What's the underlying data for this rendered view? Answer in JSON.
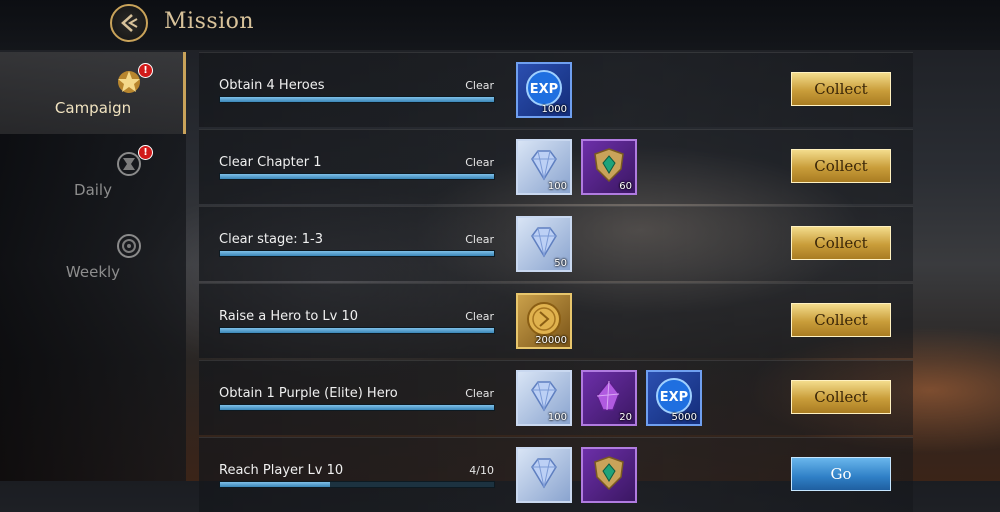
{
  "header": {
    "title": "Mission"
  },
  "sidebar": {
    "tabs": [
      {
        "label": "Campaign",
        "active": true,
        "badge": "!"
      },
      {
        "label": "Daily",
        "active": false,
        "badge": "!"
      },
      {
        "label": "Weekly",
        "active": false,
        "badge": ""
      }
    ]
  },
  "missions": [
    {
      "title": "Obtain 4 Heroes",
      "status": "Clear",
      "progress": 1.0,
      "rewards": [
        {
          "icon": "exp-icon",
          "count": "1000"
        }
      ],
      "button": "Collect"
    },
    {
      "title": "Clear Chapter 1",
      "status": "Clear",
      "progress": 1.0,
      "rewards": [
        {
          "icon": "diamond-icon",
          "count": "100"
        },
        {
          "icon": "shield-emblem-icon",
          "count": "60"
        }
      ],
      "button": "Collect"
    },
    {
      "title": "Clear stage: 1-3",
      "status": "Clear",
      "progress": 1.0,
      "rewards": [
        {
          "icon": "diamond-icon",
          "count": "50"
        }
      ],
      "button": "Collect"
    },
    {
      "title": "Raise a Hero to Lv 10",
      "status": "Clear",
      "progress": 1.0,
      "rewards": [
        {
          "icon": "gold-coin-icon",
          "count": "20000"
        }
      ],
      "button": "Collect"
    },
    {
      "title": "Obtain 1 Purple (Elite) Hero",
      "status": "Clear",
      "progress": 1.0,
      "rewards": [
        {
          "icon": "diamond-icon",
          "count": "100"
        },
        {
          "icon": "purple-crystal-icon",
          "count": "20"
        },
        {
          "icon": "exp-icon",
          "count": "5000"
        }
      ],
      "button": "Collect"
    },
    {
      "title": "Reach Player Lv 10",
      "status": "4/10",
      "progress": 0.4,
      "rewards": [
        {
          "icon": "diamond-icon",
          "count": ""
        },
        {
          "icon": "shield-emblem-icon",
          "count": ""
        }
      ],
      "button": "Go"
    }
  ],
  "colors": {
    "accent_gold": "#c9a35a",
    "progress_blue": "#4f9fd2",
    "collect_gold": "#d9b45a",
    "go_blue": "#3a8ad0"
  }
}
